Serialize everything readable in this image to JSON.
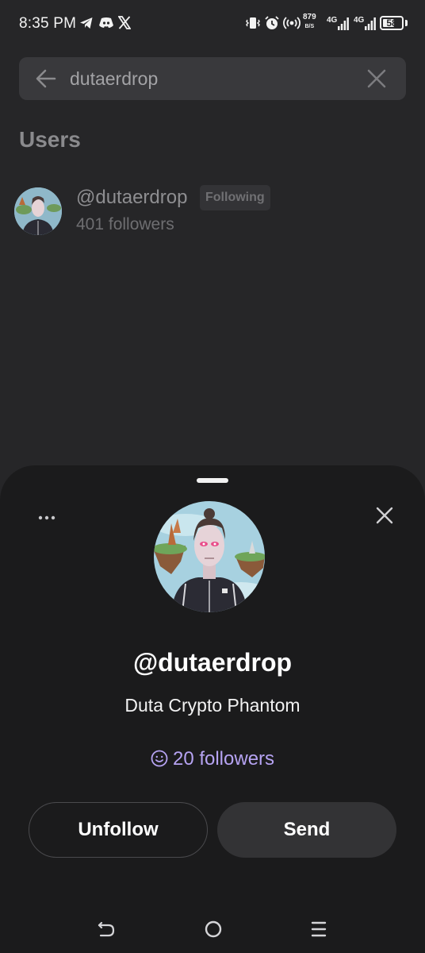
{
  "status_bar": {
    "time": "8:35 PM",
    "net_speed_value": "879",
    "net_speed_unit": "B/S",
    "network_1": "4G",
    "network_2": "4G",
    "battery_level": "58",
    "notification_icons": [
      "telegram-icon",
      "discord-icon",
      "x-icon"
    ],
    "system_icons": [
      "vibrate-icon",
      "alarm-icon",
      "hotspot-icon",
      "signal-icon",
      "signal-icon",
      "battery-icon"
    ]
  },
  "search": {
    "query": "dutaerdrop"
  },
  "users_section": {
    "title": "Users",
    "results": [
      {
        "handle": "@dutaerdrop",
        "badge": "Following",
        "followers": "401 followers"
      }
    ]
  },
  "profile_sheet": {
    "handle": "@dutaerdrop",
    "display_name": "Duta Crypto Phantom",
    "followers": "20 followers",
    "unfollow_label": "Unfollow",
    "send_label": "Send"
  },
  "colors": {
    "background": "#262628",
    "sheet": "#1b1b1c",
    "accent_followers": "#b6a3f2"
  },
  "nav_bar": [
    "back-icon",
    "home-icon",
    "recents-icon"
  ]
}
